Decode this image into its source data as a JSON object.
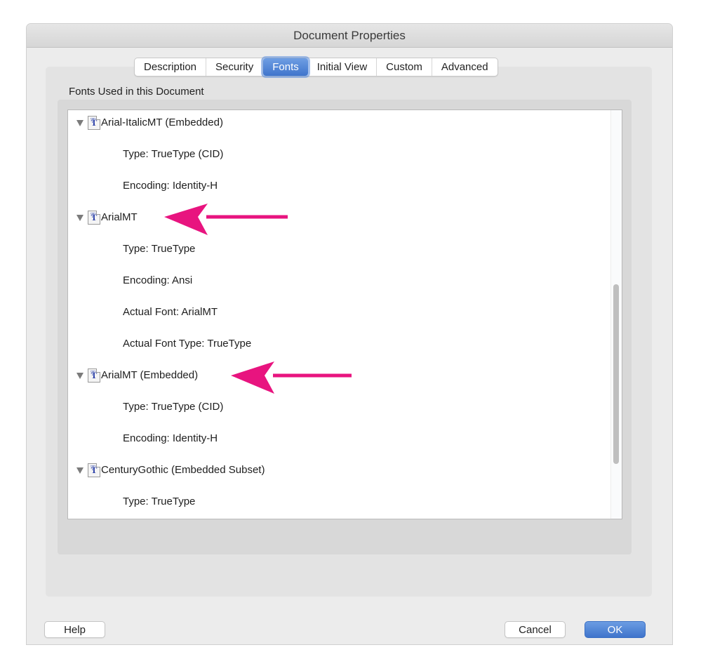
{
  "window": {
    "title": "Document Properties"
  },
  "tabs": [
    {
      "label": "Description",
      "active": false
    },
    {
      "label": "Security",
      "active": false
    },
    {
      "label": "Fonts",
      "active": true
    },
    {
      "label": "Initial View",
      "active": false
    },
    {
      "label": "Custom",
      "active": false
    },
    {
      "label": "Advanced",
      "active": false
    }
  ],
  "fonts_section": {
    "label": "Fonts Used in this Document",
    "fonts": [
      {
        "name": "Arial-ItalicMT (Embedded)",
        "icon": "truetype-font-icon",
        "expanded": true,
        "properties": [
          "Type: TrueType (CID)",
          "Encoding: Identity-H"
        ]
      },
      {
        "name": "ArialMT",
        "icon": "truetype-font-icon",
        "expanded": true,
        "highlighted_by_arrow": true,
        "properties": [
          "Type: TrueType",
          "Encoding: Ansi",
          "Actual Font: ArialMT",
          "Actual Font Type: TrueType"
        ]
      },
      {
        "name": "ArialMT (Embedded)",
        "icon": "truetype-font-icon",
        "expanded": true,
        "highlighted_by_arrow": true,
        "properties": [
          "Type: TrueType (CID)",
          "Encoding: Identity-H"
        ]
      },
      {
        "name": "CenturyGothic (Embedded Subset)",
        "icon": "truetype-font-icon",
        "expanded": true,
        "properties": [
          "Type: TrueType"
        ]
      }
    ]
  },
  "annotation": {
    "arrow_color": "#e8147f"
  },
  "buttons": {
    "help": "Help",
    "cancel": "Cancel",
    "ok": "OK"
  },
  "colors": {
    "accent": "#3f75cc"
  }
}
